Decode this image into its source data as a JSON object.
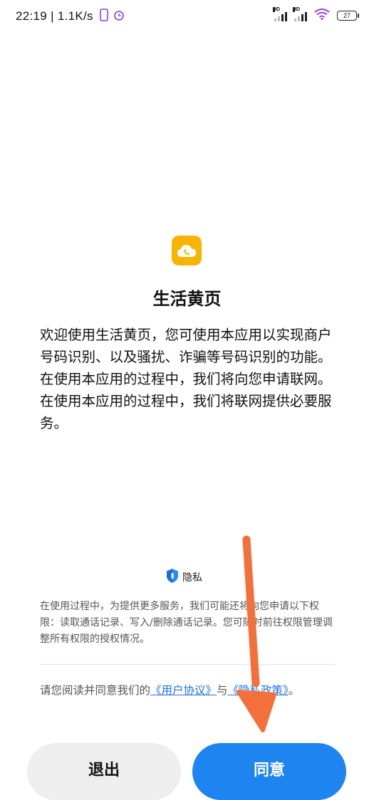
{
  "status_bar": {
    "time": "22:19",
    "speed": "1.1K/s",
    "battery": "27",
    "network_badge": "HD"
  },
  "app": {
    "title": "生活黄页",
    "intro": "欢迎使用生活黄页，您可使用本应用以实现商户号码识别、以及骚扰、诈骗等号码识别的功能。在使用本应用的过程中，我们将向您申请联网。在使用本应用的过程中，我们将联网提供必要服务。"
  },
  "privacy": {
    "badge_label": "隐私",
    "permissions_text": "在使用过程中，为提供更多服务，我们可能还将向您申请以下权限：读取通话记录、写入/删除通话记录。您可随时前往权限管理调整所有权限的授权情况。",
    "agree_prefix": "请您阅读并同意我们的",
    "user_agreement_link": "《用户协议》",
    "and_text": "与",
    "privacy_policy_link": "《隐私政策》",
    "period": "。"
  },
  "buttons": {
    "exit_label": "退出",
    "agree_label": "同意"
  },
  "colors": {
    "accent": "#1e84f0",
    "link": "#1e73e8",
    "app_icon": "#f7b400",
    "annotation_arrow": "#f4703a"
  }
}
